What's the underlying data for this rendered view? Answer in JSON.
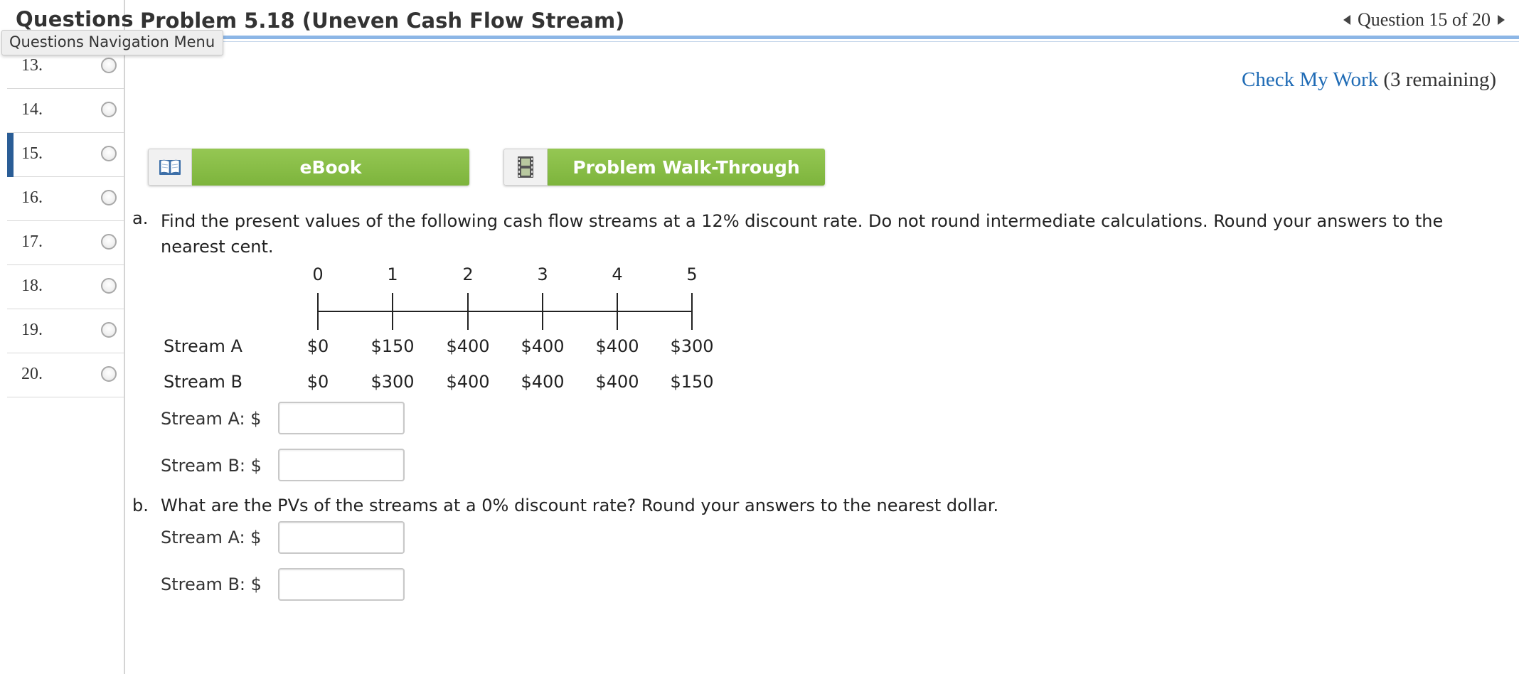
{
  "sidebar": {
    "title": "Questions",
    "tooltip": "Questions Navigation Menu",
    "items": [
      {
        "label": "13."
      },
      {
        "label": "14."
      },
      {
        "label": "15."
      },
      {
        "label": "16."
      },
      {
        "label": "17."
      },
      {
        "label": "18."
      },
      {
        "label": "19."
      },
      {
        "label": "20."
      }
    ],
    "active_item": "15."
  },
  "header": {
    "title": "Problem 5.18 (Uneven Cash Flow Stream)",
    "question_position": "Question 15 of 20"
  },
  "check_work": {
    "link": "Check My Work",
    "remaining": "(3 remaining)"
  },
  "resources": {
    "ebook": "eBook",
    "walkthrough": "Problem Walk-Through"
  },
  "part_a": {
    "letter": "a.",
    "text": "Find the present values of the following cash flow streams at a 12% discount rate. Do not round intermediate calculations. Round your answers to the nearest cent.",
    "timeline_periods": [
      "0",
      "1",
      "2",
      "3",
      "4",
      "5"
    ],
    "streams": [
      {
        "name": "Stream A",
        "values": [
          "$0",
          "$150",
          "$400",
          "$400",
          "$400",
          "$300"
        ]
      },
      {
        "name": "Stream B",
        "values": [
          "$0",
          "$300",
          "$400",
          "$400",
          "$400",
          "$150"
        ]
      }
    ],
    "answer_a_label": "Stream A: $",
    "answer_b_label": "Stream B: $",
    "answer_a_value": "",
    "answer_b_value": ""
  },
  "part_b": {
    "letter": "b.",
    "text": "What are the PVs of the streams at a 0% discount rate? Round your answers to the nearest dollar.",
    "answer_a_label": "Stream A: $",
    "answer_b_label": "Stream B: $",
    "answer_a_value": "",
    "answer_b_value": ""
  },
  "colors": {
    "accent_blue": "#2a5d96",
    "header_rule": "#8cb6e6",
    "link": "#1f6bb5",
    "button_green": "#8bc04a"
  },
  "icons": {
    "ebook": "open-book-icon",
    "walkthrough": "film-strip-icon"
  }
}
